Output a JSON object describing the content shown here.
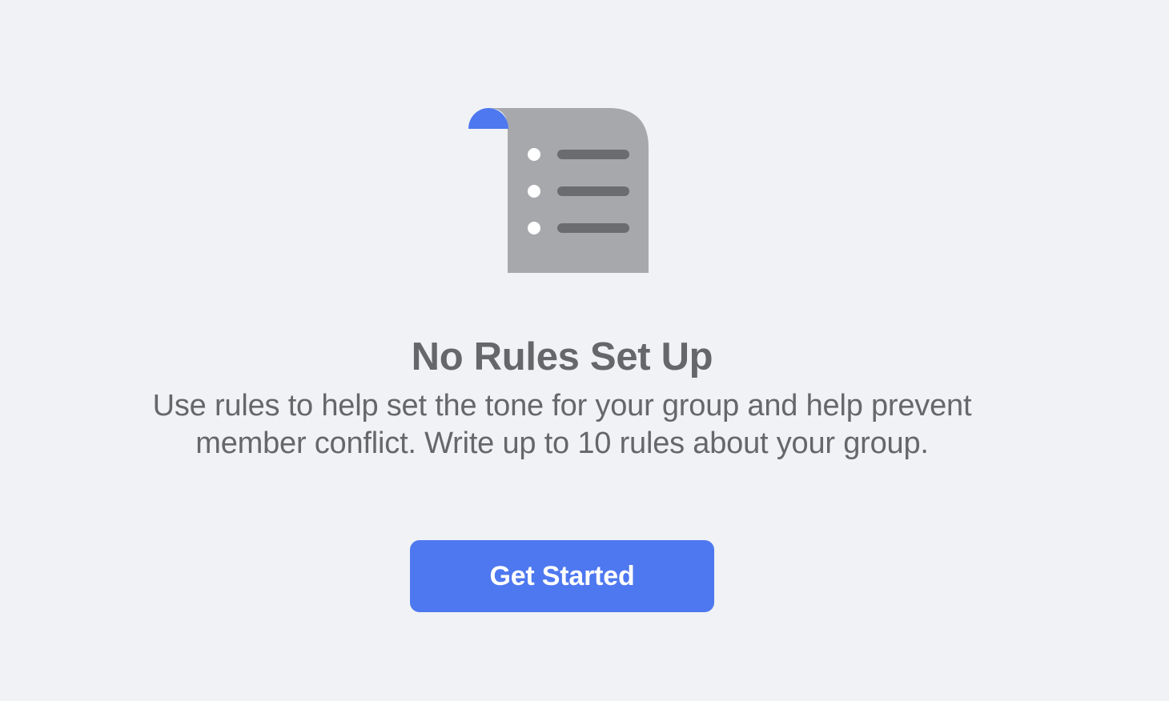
{
  "empty_state": {
    "illustration_icon": "rules-document-icon",
    "title": "No Rules Set Up",
    "description": "Use rules to help set the tone for your group and help prevent member conflict. Write up to 10 rules about your group.",
    "cta_label": "Get Started"
  },
  "colors": {
    "background": "#f0f2f5",
    "text_secondary": "#65676b",
    "accent": "#4e78ef",
    "document_gray": "#a7a8ac",
    "document_lines": "#6b6c70"
  }
}
